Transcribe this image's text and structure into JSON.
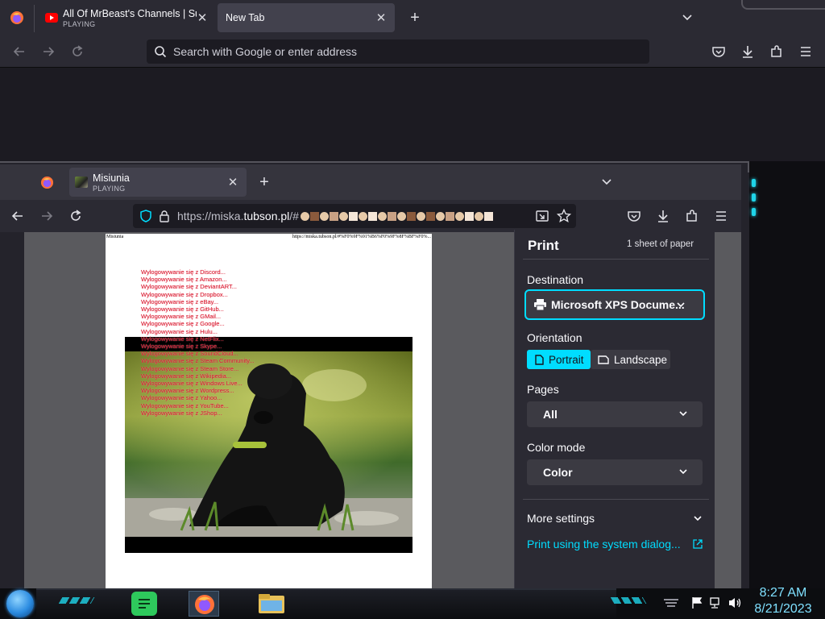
{
  "window1": {
    "tabs": [
      {
        "title": "All Of MrBeast's Channels | Sub",
        "status": "PLAYING",
        "icon": "youtube-icon"
      },
      {
        "title": "New Tab",
        "status": "",
        "icon": ""
      }
    ],
    "address_placeholder": "Search with Google or enter address"
  },
  "window2": {
    "tabs": [
      {
        "title": "Misiunia",
        "status": "PLAYING",
        "icon": "dog-thumbnail"
      }
    ],
    "url_prefix": "https://miska.",
    "url_domain": "tubson.pl",
    "url_suffix": "/#"
  },
  "preview": {
    "header_left": "Misiunia",
    "header_right": "https://miska.tubson.pl/#%F0%9F%91%B6%F0%9F%8F%BF%F0%...",
    "logout_lines": [
      "Wylogowywanie się z Discord...",
      "Wylogowywanie się z Amazon...",
      "Wylogowywanie się z DeviantART...",
      "Wylogowywanie się z Dropbox...",
      "Wylogowywanie się z eBay...",
      "Wylogowywanie się z GitHub...",
      "Wylogowywanie się z GMail...",
      "Wylogowywanie się z Google...",
      "Wylogowywanie się z Hulu...",
      "Wylogowywanie się z NetFlix...",
      "Wylogowywanie się z Skype...",
      "Wylogowywanie się z SoundCloud...",
      "Wylogowywanie się z Steam Community...",
      "Wylogowywanie się z Steam Store...",
      "Wylogowywanie się z Wikipedia...",
      "Wylogowywanie się z Windows Live...",
      "Wylogowywanie się z Wordpress...",
      "Wylogowywanie się z Yahoo...",
      "Wylogowywanie się z YouTube...",
      "Wylogowywanie się z JShop..."
    ]
  },
  "print_panel": {
    "title": "Print",
    "sheets": "1 sheet of paper",
    "destination_label": "Destination",
    "destination_value": "Microsoft XPS Docume...",
    "orientation_label": "Orientation",
    "portrait": "Portrait",
    "landscape": "Landscape",
    "pages_label": "Pages",
    "pages_value": "All",
    "color_mode_label": "Color mode",
    "color_mode_value": "Color",
    "more_settings": "More settings",
    "system_dialog": "Print using the system dialog..."
  },
  "taskbar": {
    "time": "8:27 AM",
    "date": "8/21/2023"
  },
  "colors": {
    "accent": "#00ddff",
    "link": "#00ddff",
    "logout_text": "#d4142a"
  }
}
